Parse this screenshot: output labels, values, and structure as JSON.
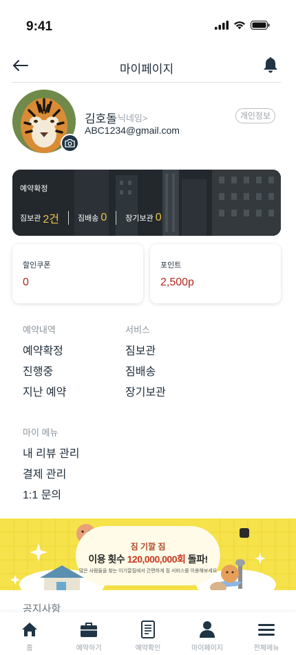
{
  "status_bar": {
    "time": "9:41",
    "icons": [
      "signal-icon",
      "wifi-icon",
      "battery-icon"
    ]
  },
  "header": {
    "title": "마이페이지",
    "back_icon": "back-arrow-icon",
    "alert_icon": "bell-icon"
  },
  "profile": {
    "name": "김호돌",
    "nickname_link": "닉네임>",
    "email": "ABC1234@gmail.com",
    "personal_info_button": "개인정보",
    "camera_icon": "camera-icon"
  },
  "reservation_summary": {
    "title": "예약확정",
    "stats": [
      {
        "label": "짐보관",
        "value": "2건"
      },
      {
        "label": "짐배송",
        "value": "0"
      },
      {
        "label": "장기보관",
        "value": "0"
      }
    ]
  },
  "wallet": {
    "coupon": {
      "label": "할인쿠폰",
      "value": "0"
    },
    "points": {
      "label": "포인트",
      "value": "2,500p"
    }
  },
  "menus": {
    "reservations": {
      "heading": "예약내역",
      "items": [
        "예약확정",
        "진행중",
        "지난 예약"
      ]
    },
    "services": {
      "heading": "서비스",
      "items": [
        "짐보관",
        "짐배송",
        "장기보관"
      ]
    },
    "my_menu": {
      "heading": "마이 메뉴",
      "items": [
        "내 리뷰 관리",
        "결제 관리",
        "1:1 문의"
      ]
    }
  },
  "promo_banner": {
    "logo": "짐 기깔 짐",
    "headline_prefix": "이용 횟수 ",
    "headline_highlight": "120,000,000회",
    "headline_suffix": " 돌파!",
    "subtext": "많은 사람들을 찾는 이기깔짐에서 간편하게 짐 서비스를 이용해보세요"
  },
  "notice": {
    "title": "공지사항"
  },
  "tab_bar": [
    {
      "label": "홈",
      "icon": "home-icon"
    },
    {
      "label": "예약하기",
      "icon": "suitcase-icon"
    },
    {
      "label": "예약확인",
      "icon": "document-icon"
    },
    {
      "label": "마이페이지",
      "icon": "user-icon"
    },
    {
      "label": "전체메뉴",
      "icon": "menu-icon"
    }
  ],
  "colors": {
    "primary": "#1f3444",
    "accent_gold": "#f0c44c",
    "value_red": "#b3261e",
    "promo_yellow": "#f6e24b"
  }
}
